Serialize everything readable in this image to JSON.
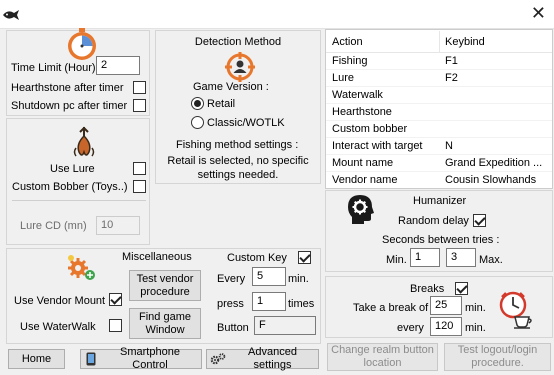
{
  "window": {
    "close_glyph": "✕"
  },
  "timer": {
    "time_limit_label": "Time Limit (Hour)",
    "time_limit_value": "2",
    "hearthstone_label": "Hearthstone after timer",
    "hearthstone_checked": false,
    "shutdown_label": "Shutdown pc after timer",
    "shutdown_checked": false
  },
  "lure": {
    "use_lure_label": "Use Lure",
    "use_lure_checked": false,
    "custom_bobber_label": "Custom Bobber (Toys..)",
    "custom_bobber_checked": false,
    "lure_cd_label": "Lure CD (mn)",
    "lure_cd_value": "10"
  },
  "detection": {
    "title": "Detection Method",
    "game_version_label": "Game Version :",
    "options": [
      "Retail",
      "Classic/WOTLK"
    ],
    "selected": "Retail",
    "settings_label": "Fishing method settings :",
    "settings_text": "Retail is selected, no specific settings needed."
  },
  "keybinds": {
    "header_action": "Action",
    "header_keybind": "Keybind",
    "rows": [
      {
        "action": "Fishing",
        "key": "F1"
      },
      {
        "action": "Lure",
        "key": "F2"
      },
      {
        "action": "Waterwalk",
        "key": ""
      },
      {
        "action": "Hearthstone",
        "key": ""
      },
      {
        "action": "Custom bobber",
        "key": ""
      },
      {
        "action": "Interact with target",
        "key": "N"
      },
      {
        "action": "Mount name",
        "key": "Grand Expedition ..."
      },
      {
        "action": "Vendor name",
        "key": "Cousin Slowhands"
      }
    ]
  },
  "humanizer": {
    "title": "Humanizer",
    "random_delay_label": "Random delay",
    "random_delay_checked": true,
    "seconds_label": "Seconds between tries :",
    "min_label": "Min.",
    "min_value": "1",
    "max_value": "3",
    "max_label": "Max."
  },
  "misc": {
    "title": "Miscellaneous",
    "test_vendor_label": "Test vendor procedure",
    "find_window_label": "Find game Window",
    "use_vendor_mount_label": "Use Vendor Mount",
    "use_vendor_mount_checked": true,
    "use_waterwalk_label": "Use WaterWalk",
    "use_waterwalk_checked": false,
    "custom_key_label": "Custom Key",
    "custom_key_checked": true,
    "every_label": "Every",
    "every_value": "5",
    "min_unit": "min.",
    "press_label": "press",
    "press_value": "1",
    "times_unit": "times",
    "button_label": "Button",
    "button_value": "F"
  },
  "breaks": {
    "label": "Breaks",
    "checked": true,
    "take_break_label": "Take a break of",
    "take_break_value": "25",
    "take_break_unit": "min.",
    "every_label": "every",
    "every_value": "120",
    "every_unit": "min."
  },
  "bottom": {
    "home_label": "Home",
    "smartphone_label": "Smartphone Control",
    "advanced_label": "Advanced settings",
    "change_realm_label": "Change realm button location",
    "test_logout_label": "Test logout/login procedure."
  },
  "colors": {
    "accent_orange": "#e8772e",
    "clock_blue": "#5b8fd6",
    "disabled_text": "#8c8c8c"
  }
}
